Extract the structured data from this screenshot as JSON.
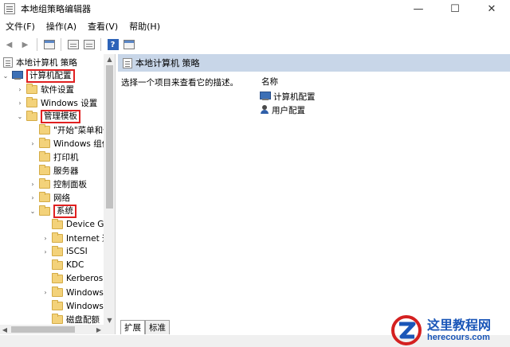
{
  "window": {
    "title": "本地组策略编辑器",
    "controls": {
      "minimize": "—",
      "maximize": "☐",
      "close": "✕"
    }
  },
  "menu": [
    "文件(F)",
    "操作(A)",
    "查看(V)",
    "帮助(H)"
  ],
  "toolbar": {
    "back": "◀",
    "forward": "▶",
    "help": "?"
  },
  "tree": {
    "root": "本地计算机 策略",
    "computer_config": "计算机配置",
    "software_settings": "软件设置",
    "windows_settings": "Windows 设置",
    "admin_templates": "管理模板",
    "start_menu": "\"开始\"菜单和任务栏",
    "windows_components": "Windows 组件",
    "printers": "打印机",
    "servers": "服务器",
    "control_panel": "控制面板",
    "network": "网络",
    "system": "系统",
    "device_guard": "Device Guard",
    "internet_comm": "Internet 通信管理",
    "iscsi": "iSCSI",
    "kdc": "KDC",
    "kerberos": "Kerberos",
    "windows1": "Windows 文件保护",
    "windows2": "Windows 时间服务",
    "disk_quota": "磁盘配额"
  },
  "scroll": {
    "up": "▲",
    "down": "▼",
    "left": "◀",
    "right": "▶"
  },
  "tree_twisty": {
    "expanded": "⌄",
    "collapsed": "›"
  },
  "right": {
    "header": "本地计算机 策略",
    "description": "选择一个项目来查看它的描述。",
    "column_name": "名称",
    "items": [
      "计算机配置",
      "用户配置"
    ],
    "tabs": [
      "扩展",
      "标准"
    ]
  },
  "watermark": {
    "title": "这里教程网",
    "url": "herecours.com"
  },
  "colors": {
    "highlight": "#e02020",
    "header_bg": "#c8d6e8",
    "watermark_blue": "#1a56b8",
    "watermark_red": "#d42020"
  }
}
